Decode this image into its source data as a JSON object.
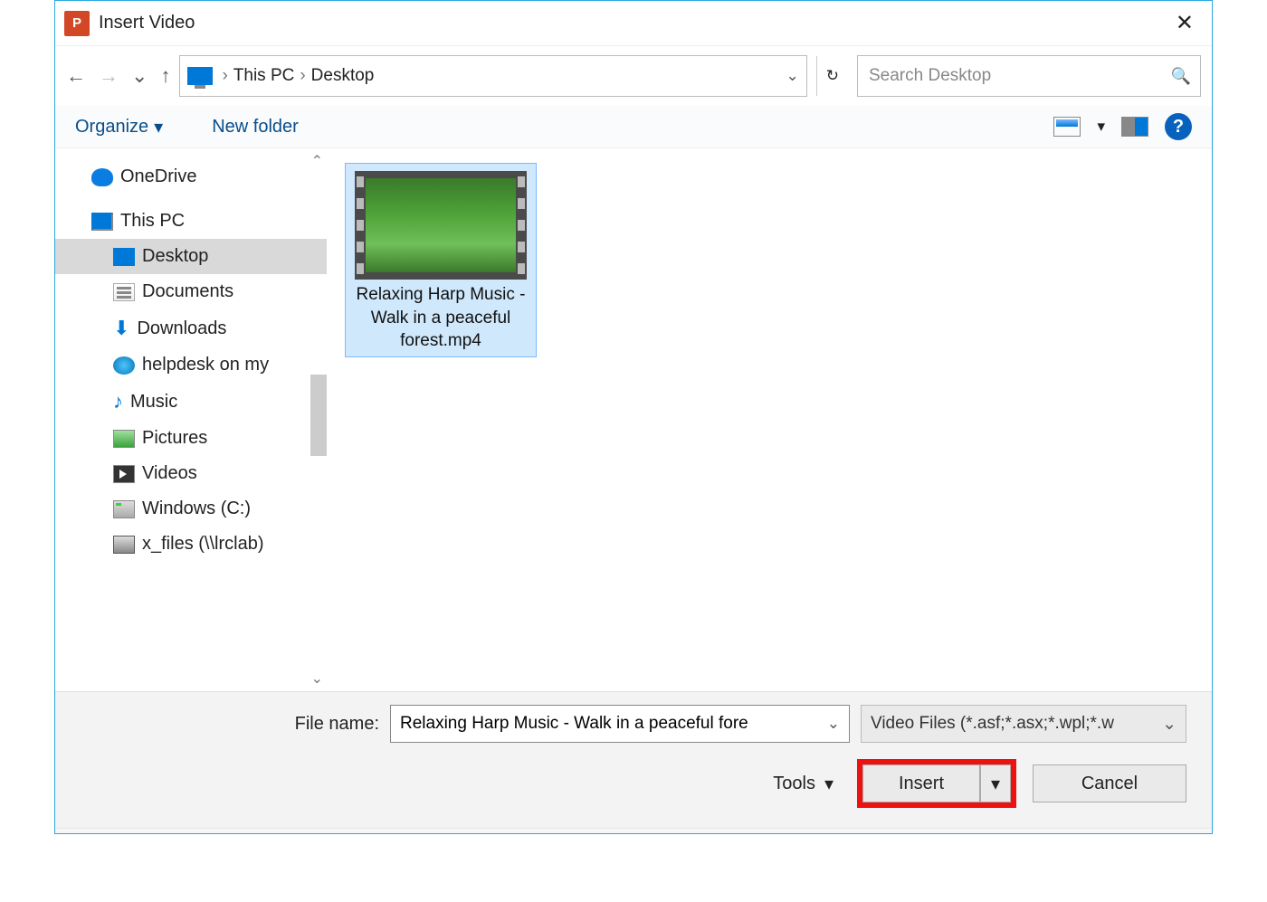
{
  "titleBar": {
    "appIconText": "P",
    "title": "Insert Video",
    "closeGlyph": "✕"
  },
  "nav": {
    "backGlyph": "←",
    "forwardGlyph": "→",
    "recentDropGlyph": "⌄",
    "upGlyph": "↑",
    "crumbs": [
      "This PC",
      "Desktop"
    ],
    "crumbSep": "›",
    "addrDropGlyph": "⌄",
    "refreshGlyph": "↻",
    "searchPlaceholder": "Search Desktop",
    "searchGlyph": "🔍"
  },
  "toolbar": {
    "organize": "Organize",
    "organizeDropGlyph": "▾",
    "newFolder": "New folder",
    "viewDropGlyph": "▾",
    "helpGlyph": "?"
  },
  "tree": {
    "items": [
      {
        "label": "OneDrive",
        "icon": "onedrive",
        "indent": 1
      },
      {
        "label": "This PC",
        "icon": "pc",
        "indent": 1
      },
      {
        "label": "Desktop",
        "icon": "desktop",
        "indent": 2,
        "selected": true
      },
      {
        "label": "Documents",
        "icon": "folder-doc",
        "indent": 2
      },
      {
        "label": "Downloads",
        "icon": "download",
        "indent": 2
      },
      {
        "label": "helpdesk on my",
        "icon": "globe",
        "indent": 2
      },
      {
        "label": "Music",
        "icon": "music",
        "indent": 2
      },
      {
        "label": "Pictures",
        "icon": "pictures",
        "indent": 2
      },
      {
        "label": "Videos",
        "icon": "videos",
        "indent": 2
      },
      {
        "label": "Windows (C:)",
        "icon": "drive",
        "indent": 2
      },
      {
        "label": "x_files (\\\\lrclab)",
        "icon": "netdrive",
        "indent": 2
      }
    ],
    "scrollUpGlyph": "⌃",
    "scrollDownGlyph": "⌄"
  },
  "content": {
    "files": [
      {
        "name": "Relaxing Harp Music - Walk in a peaceful forest.mp4",
        "selected": true
      }
    ]
  },
  "footer": {
    "fileNameLabel": "File name:",
    "fileNameValue": "Relaxing Harp Music - Walk in a peaceful fore",
    "typeFilter": "Video Files (*.asf;*.asx;*.wpl;*.w",
    "tools": "Tools",
    "toolsDropGlyph": "▾",
    "insert": "Insert",
    "insertDropGlyph": "▾",
    "cancel": "Cancel"
  }
}
